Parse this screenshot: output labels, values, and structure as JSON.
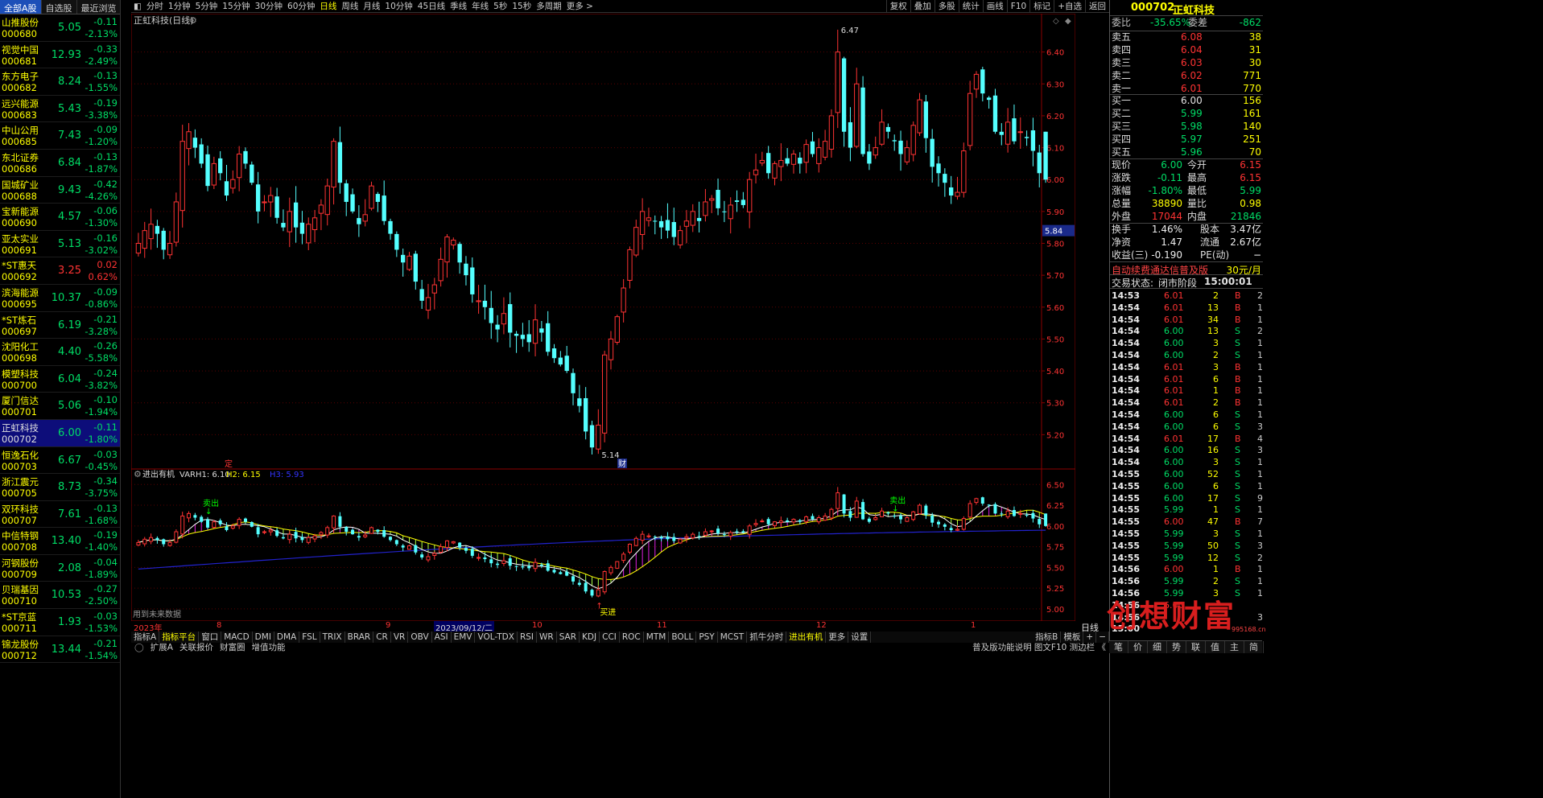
{
  "left_tabs": [
    "全部A股",
    "自选股",
    "最近浏览"
  ],
  "stocks": [
    {
      "name": "山推股份",
      "code": "000680",
      "price": "5.05",
      "chg": "-0.11",
      "pct": "-2.13%",
      "dir": "dn"
    },
    {
      "name": "视觉中国",
      "code": "000681",
      "price": "12.93",
      "chg": "-0.33",
      "pct": "-2.49%",
      "dir": "dn"
    },
    {
      "name": "东方电子",
      "code": "000682",
      "price": "8.24",
      "chg": "-0.13",
      "pct": "-1.55%",
      "dir": "dn"
    },
    {
      "name": "远兴能源",
      "code": "000683",
      "price": "5.43",
      "chg": "-0.19",
      "pct": "-3.38%",
      "dir": "dn"
    },
    {
      "name": "中山公用",
      "code": "000685",
      "price": "7.43",
      "chg": "-0.09",
      "pct": "-1.20%",
      "dir": "dn"
    },
    {
      "name": "东北证券",
      "code": "000686",
      "price": "6.84",
      "chg": "-0.13",
      "pct": "-1.87%",
      "dir": "dn"
    },
    {
      "name": "国城矿业",
      "code": "000688",
      "price": "9.43",
      "chg": "-0.42",
      "pct": "-4.26%",
      "dir": "dn"
    },
    {
      "name": "宝新能源",
      "code": "000690",
      "price": "4.57",
      "chg": "-0.06",
      "pct": "-1.30%",
      "dir": "dn"
    },
    {
      "name": "亚太实业",
      "code": "000691",
      "price": "5.13",
      "chg": "-0.16",
      "pct": "-3.02%",
      "dir": "dn"
    },
    {
      "name": "*ST惠天",
      "code": "000692",
      "price": "3.25",
      "chg": "0.02",
      "pct": "0.62%",
      "dir": "up"
    },
    {
      "name": "滨海能源",
      "code": "000695",
      "price": "10.37",
      "chg": "-0.09",
      "pct": "-0.86%",
      "dir": "dn"
    },
    {
      "name": "*ST炼石",
      "code": "000697",
      "price": "6.19",
      "chg": "-0.21",
      "pct": "-3.28%",
      "dir": "dn"
    },
    {
      "name": "沈阳化工",
      "code": "000698",
      "price": "4.40",
      "chg": "-0.26",
      "pct": "-5.58%",
      "dir": "dn"
    },
    {
      "name": "模塑科技",
      "code": "000700",
      "price": "6.04",
      "chg": "-0.24",
      "pct": "-3.82%",
      "dir": "dn"
    },
    {
      "name": "厦门信达",
      "code": "000701",
      "price": "5.06",
      "chg": "-0.10",
      "pct": "-1.94%",
      "dir": "dn"
    },
    {
      "name": "正虹科技",
      "code": "000702",
      "price": "6.00",
      "chg": "-0.11",
      "pct": "-1.80%",
      "dir": "dn",
      "sel": true
    },
    {
      "name": "恒逸石化",
      "code": "000703",
      "price": "6.67",
      "chg": "-0.03",
      "pct": "-0.45%",
      "dir": "dn"
    },
    {
      "name": "浙江震元",
      "code": "000705",
      "price": "8.73",
      "chg": "-0.34",
      "pct": "-3.75%",
      "dir": "dn"
    },
    {
      "name": "双环科技",
      "code": "000707",
      "price": "7.61",
      "chg": "-0.13",
      "pct": "-1.68%",
      "dir": "dn"
    },
    {
      "name": "中信特钢",
      "code": "000708",
      "price": "13.40",
      "chg": "-0.19",
      "pct": "-1.40%",
      "dir": "dn"
    },
    {
      "name": "河钢股份",
      "code": "000709",
      "price": "2.08",
      "chg": "-0.04",
      "pct": "-1.89%",
      "dir": "dn"
    },
    {
      "name": "贝瑞基因",
      "code": "000710",
      "price": "10.53",
      "chg": "-0.27",
      "pct": "-2.50%",
      "dir": "dn"
    },
    {
      "name": "*ST京蓝",
      "code": "000711",
      "price": "1.93",
      "chg": "-0.03",
      "pct": "-1.53%",
      "dir": "dn"
    },
    {
      "name": "锦龙股份",
      "code": "000712",
      "price": "13.44",
      "chg": "-0.21",
      "pct": "-1.54%",
      "dir": "dn"
    }
  ],
  "period_tabs": [
    "分时",
    "1分钟",
    "5分钟",
    "15分钟",
    "30分钟",
    "60分钟",
    "日线",
    "周线",
    "月线",
    "10分钟",
    "45日线",
    "季线",
    "年线",
    "5秒",
    "15秒",
    "多周期",
    "更多 >"
  ],
  "period_active": "日线",
  "right_tools": [
    "复权",
    "叠加",
    "多股",
    "统计",
    "画线",
    "F10",
    "标记",
    "+自选",
    "返回"
  ],
  "chart_title": "正虹科技(日线)",
  "price_axis": [
    "6.40",
    "6.30",
    "6.20",
    "6.10",
    "6.00",
    "5.90",
    "5.80",
    "5.70",
    "5.60",
    "5.50",
    "5.40",
    "5.30",
    "5.20"
  ],
  "current_price_tag": "5.84",
  "max_label": "6.47",
  "min_label": "5.14",
  "marker_ding": "定",
  "marker_cai": "财",
  "indicator": {
    "name": "进出有机",
    "varh1": "VARH1: 6.10",
    "h2": "H2: 6.15",
    "h3": "H3: 5.93",
    "axis": [
      "6.50",
      "6.25",
      "6.00",
      "5.75",
      "5.50",
      "5.25",
      "5.00"
    ],
    "sell": "卖出",
    "buy": "买进",
    "note": "用到未来数据"
  },
  "x_axis": [
    "2023年",
    "8",
    "9",
    "2023/09/12/二",
    "10",
    "11",
    "12",
    "1"
  ],
  "x_axis_right": "日线",
  "ind_tabs": [
    "指标A",
    "指标平台",
    "窗口",
    "MACD",
    "DMI",
    "DMA",
    "FSL",
    "TRIX",
    "BRAR",
    "CR",
    "VR",
    "OBV",
    "ASI",
    "EMV",
    "VOL-TDX",
    "RSI",
    "WR",
    "SAR",
    "KDJ",
    "CCI",
    "ROC",
    "MTM",
    "BOLL",
    "PSY",
    "MCST",
    "抓牛分时",
    "进出有机",
    "更多",
    "设置"
  ],
  "ind_active": [
    "指标平台",
    "进出有机"
  ],
  "ind_tabs_right": [
    "指标B",
    "模板",
    "+",
    "−"
  ],
  "bottom_tabs": [
    "扩展A",
    "关联报价",
    "财富圈",
    "增值功能"
  ],
  "bottom_right": "普及版功能说明  图文F10  测边栏 《",
  "quote": {
    "code": "000702",
    "name": "正虹科技",
    "weibi_label": "委比",
    "weibi": "-35.65%",
    "weicha_label": "委差",
    "weicha": "-862",
    "asks": [
      {
        "l": "卖五",
        "p": "6.08",
        "v": "38"
      },
      {
        "l": "卖四",
        "p": "6.04",
        "v": "31"
      },
      {
        "l": "卖三",
        "p": "6.03",
        "v": "30"
      },
      {
        "l": "卖二",
        "p": "6.02",
        "v": "771"
      },
      {
        "l": "卖一",
        "p": "6.01",
        "v": "770"
      }
    ],
    "bids": [
      {
        "l": "买一",
        "p": "6.00",
        "v": "156"
      },
      {
        "l": "买二",
        "p": "5.99",
        "v": "161"
      },
      {
        "l": "买三",
        "p": "5.98",
        "v": "140"
      },
      {
        "l": "买四",
        "p": "5.97",
        "v": "251"
      },
      {
        "l": "买五",
        "p": "5.96",
        "v": "70"
      }
    ],
    "stats": [
      {
        "l1": "现价",
        "v1": "6.00",
        "c1": "dn",
        "l2": "今开",
        "v2": "6.15",
        "c2": "up"
      },
      {
        "l1": "涨跌",
        "v1": "-0.11",
        "c1": "dn",
        "l2": "最高",
        "v2": "6.15",
        "c2": "up"
      },
      {
        "l1": "涨幅",
        "v1": "-1.80%",
        "c1": "dn",
        "l2": "最低",
        "v2": "5.99",
        "c2": "dn"
      },
      {
        "l1": "总量",
        "v1": "38890",
        "c1": "yl",
        "l2": "量比",
        "v2": "0.98",
        "c2": "yl"
      },
      {
        "l1": "外盘",
        "v1": "17044",
        "c1": "up",
        "l2": "内盘",
        "v2": "21846",
        "c2": "dn"
      }
    ],
    "stats2": [
      {
        "l1": "换手",
        "v1": "1.46%",
        "l2": "股本",
        "v2": "3.47亿"
      },
      {
        "l1": "净资",
        "v1": "1.47",
        "l2": "流通",
        "v2": "2.67亿"
      },
      {
        "l1": "收益(三)",
        "v1": "-0.190",
        "l2": "PE(动)",
        "v2": "−"
      }
    ],
    "ad": "自动续费通达信普及版",
    "ad_price": "30元/月",
    "trade_status_label": "交易状态:",
    "trade_status": "闭市阶段",
    "trade_time": "15:00:01",
    "ticks": [
      [
        "14:53",
        "6.01",
        "2",
        "B",
        "2",
        "up"
      ],
      [
        "14:54",
        "6.01",
        "13",
        "B",
        "1",
        "up"
      ],
      [
        "14:54",
        "6.01",
        "34",
        "B",
        "1",
        "up"
      ],
      [
        "14:54",
        "6.00",
        "13",
        "S",
        "2",
        "dn"
      ],
      [
        "14:54",
        "6.00",
        "3",
        "S",
        "1",
        "dn"
      ],
      [
        "14:54",
        "6.00",
        "2",
        "S",
        "1",
        "dn"
      ],
      [
        "14:54",
        "6.01",
        "3",
        "B",
        "1",
        "up"
      ],
      [
        "14:54",
        "6.01",
        "6",
        "B",
        "1",
        "up"
      ],
      [
        "14:54",
        "6.01",
        "1",
        "B",
        "1",
        "up"
      ],
      [
        "14:54",
        "6.01",
        "2",
        "B",
        "1",
        "up"
      ],
      [
        "14:54",
        "6.00",
        "6",
        "S",
        "1",
        "dn"
      ],
      [
        "14:54",
        "6.00",
        "6",
        "S",
        "3",
        "dn"
      ],
      [
        "14:54",
        "6.01",
        "17",
        "B",
        "4",
        "up"
      ],
      [
        "14:54",
        "6.00",
        "16",
        "S",
        "3",
        "dn"
      ],
      [
        "14:54",
        "6.00",
        "3",
        "S",
        "1",
        "dn"
      ],
      [
        "14:55",
        "6.00",
        "52",
        "S",
        "1",
        "dn"
      ],
      [
        "14:55",
        "6.00",
        "6",
        "S",
        "1",
        "dn"
      ],
      [
        "14:55",
        "6.00",
        "17",
        "S",
        "9",
        "dn"
      ],
      [
        "14:55",
        "5.99",
        "1",
        "S",
        "1",
        "dn"
      ],
      [
        "14:55",
        "6.00",
        "47",
        "B",
        "7",
        "up"
      ],
      [
        "14:55",
        "5.99",
        "3",
        "S",
        "1",
        "dn"
      ],
      [
        "14:55",
        "5.99",
        "50",
        "S",
        "3",
        "dn"
      ],
      [
        "14:55",
        "5.99",
        "12",
        "S",
        "2",
        "dn"
      ],
      [
        "14:56",
        "6.00",
        "1",
        "B",
        "1",
        "up"
      ],
      [
        "14:56",
        "5.99",
        "2",
        "S",
        "1",
        "dn"
      ],
      [
        "14:56",
        "5.99",
        "3",
        "S",
        "1",
        "dn"
      ],
      [
        "14:56",
        "6.00",
        "",
        "",
        "",
        "up"
      ],
      [
        "14:56",
        "",
        "",
        "",
        "32",
        "up"
      ],
      [
        "15:00",
        "",
        "",
        "",
        "",
        "up"
      ]
    ],
    "right_bar": [
      "笔",
      "价",
      "细",
      "势",
      "联",
      "值",
      "主",
      "简"
    ]
  },
  "watermark": "创想财富",
  "watermark_url": "995168.cn",
  "chart_data": {
    "type": "candlestick",
    "title": "正虹科技(日线)",
    "ylim": [
      5.1,
      6.5
    ],
    "x_ticks": [
      "2023年",
      "8",
      "9",
      "2023/09/12/二",
      "10",
      "11",
      "12",
      "1"
    ],
    "extremes": {
      "max": 6.47,
      "min": 5.14
    },
    "series": [
      {
        "name": "K线",
        "closes": [
          5.8,
          5.84,
          5.86,
          5.83,
          5.78,
          5.8,
          5.93,
          6.12,
          6.15,
          6.1,
          6.05,
          5.98,
          6.05,
          6.02,
          5.95,
          6.0,
          6.08,
          6.05,
          5.99,
          5.9,
          5.93,
          5.95,
          5.88,
          5.85,
          5.9,
          5.85,
          5.83,
          5.86,
          5.88,
          5.92,
          5.98,
          6.12,
          5.99,
          5.93,
          5.9,
          5.86,
          5.89,
          5.98,
          5.93,
          5.87,
          5.83,
          5.78,
          5.74,
          5.76,
          5.68,
          5.62,
          5.63,
          5.67,
          5.75,
          5.82,
          5.81,
          5.74,
          5.7,
          5.64,
          5.62,
          5.6,
          5.55,
          5.53,
          5.58,
          5.52,
          5.51,
          5.5,
          5.49,
          5.56,
          5.52,
          5.46,
          5.44,
          5.42,
          5.4,
          5.33,
          5.29,
          5.21,
          5.16,
          5.23,
          5.45,
          5.5,
          5.57,
          5.66,
          5.78,
          5.85,
          5.9,
          5.88,
          5.87,
          5.85,
          5.84,
          5.82,
          5.84,
          5.87,
          5.9,
          5.87,
          5.93,
          5.94,
          5.91,
          5.9,
          5.92,
          5.93,
          5.92,
          6.0,
          6.03,
          6.06,
          6.02,
          6.05,
          6.06,
          6.05,
          6.08,
          6.05,
          6.11,
          6.08,
          6.1,
          6.12,
          6.2,
          6.4,
          6.15,
          6.1,
          6.3,
          6.08,
          6.05,
          6.1,
          6.18,
          6.15,
          6.12,
          6.08,
          6.1,
          6.17,
          6.25,
          6.13,
          6.04,
          6.02,
          5.99,
          5.95,
          5.96,
          6.09,
          6.27,
          6.33,
          6.27,
          6.25,
          6.15,
          6.14,
          6.18,
          6.12,
          6.15,
          6.13,
          6.09,
          6.02,
          6.0
        ]
      }
    ]
  }
}
